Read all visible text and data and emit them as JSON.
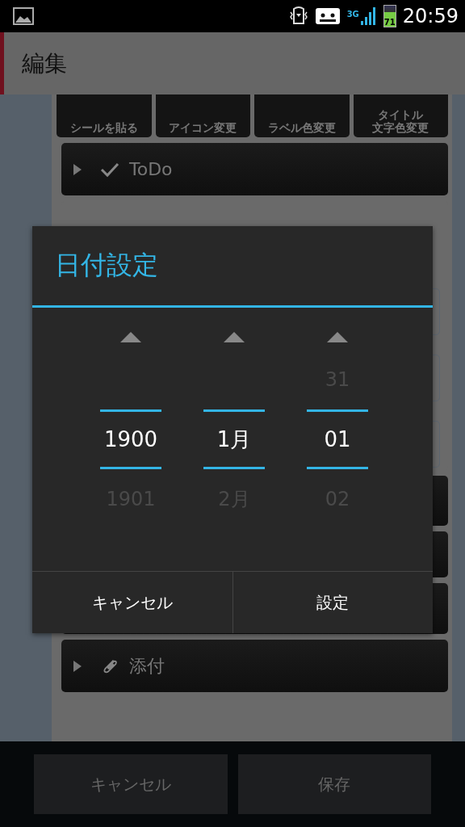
{
  "status_bar": {
    "network": "3G",
    "battery_percent": "71",
    "time": "20:59"
  },
  "title": "編集",
  "toolbar": [
    {
      "lines": [
        "シールを貼る"
      ]
    },
    {
      "lines": [
        "アイコン変更"
      ]
    },
    {
      "lines": [
        "ラベル色変更"
      ]
    },
    {
      "lines": [
        "タイトル",
        "文字色変更"
      ]
    }
  ],
  "sections": [
    {
      "kind": "check",
      "label": "ToDo",
      "expanded": false
    },
    {
      "kind": "clip",
      "label": "添付",
      "expanded": false
    }
  ],
  "dialog": {
    "title": "日付設定",
    "pickers": [
      {
        "current": "1900",
        "next": "1901"
      },
      {
        "current": "1月",
        "next": "2月"
      },
      {
        "prev": "31",
        "current": "01",
        "next": "02"
      }
    ],
    "buttons": [
      "キャンセル",
      "設定"
    ]
  },
  "bottom_buttons": [
    "キャンセル",
    "保存"
  ]
}
